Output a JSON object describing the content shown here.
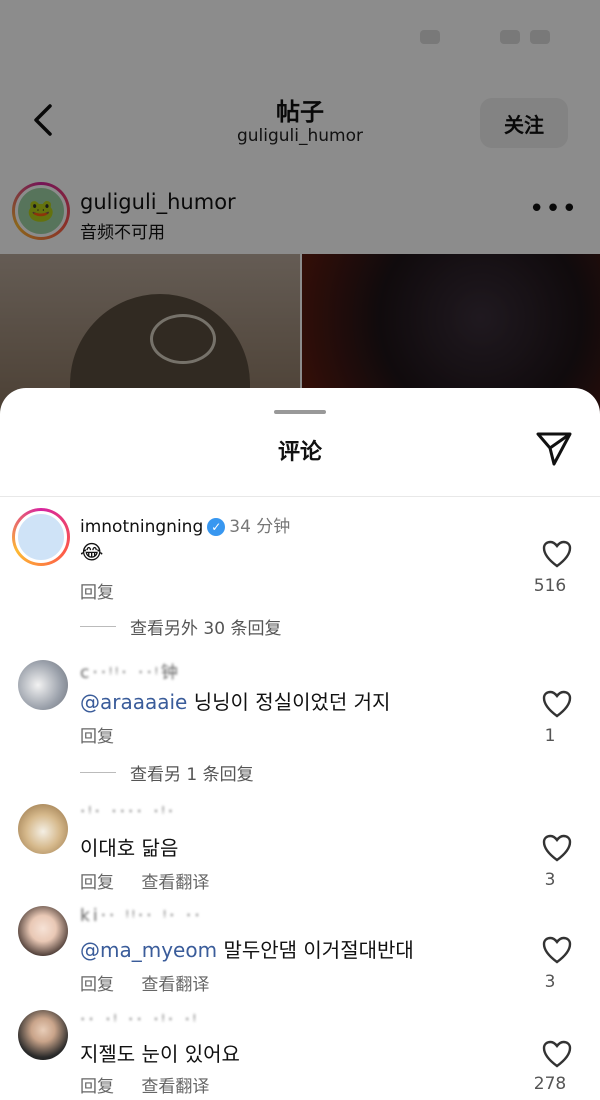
{
  "header": {
    "title": "帖子",
    "subtitle": "guliguli_humor",
    "follow_label": "关注"
  },
  "post": {
    "username": "guliguli_humor",
    "audio_status": "音频不可用",
    "more_label": "•••"
  },
  "sheet": {
    "title": "评论"
  },
  "comments": [
    {
      "user": "imnotningning",
      "verified": true,
      "time": "34 分钟",
      "text": "😂",
      "reply_label": "回复",
      "likes": "516",
      "view_more": "查看另外 30 条回复"
    },
    {
      "user": "c··ᵎᵎ·  ··ᵎ钟",
      "mention": "@araaaaie",
      "text": " 닝닝이 정실이었던 거지",
      "reply_label": "回复",
      "likes": "1",
      "view_more": "查看另 1 条回复"
    },
    {
      "user": "·ᵎ· ···· ·ᵎ·",
      "text": "이대호 닮음",
      "reply_label": "回复",
      "translate_label": "查看翻译",
      "likes": "3"
    },
    {
      "user": "ki·· ᵎᵎ·· ᵎ· ··",
      "mention": "@ma_myeom",
      "text": " 말두안댐 이거절대반대",
      "reply_label": "回复",
      "translate_label": "查看翻译",
      "likes": "3"
    },
    {
      "user": "·· ·ᵎ ·· ·ᵎ·  ·ᵎ",
      "text": "지젤도 눈이 있어요",
      "reply_label": "回复",
      "translate_label": "查看翻译",
      "likes": "278"
    }
  ]
}
